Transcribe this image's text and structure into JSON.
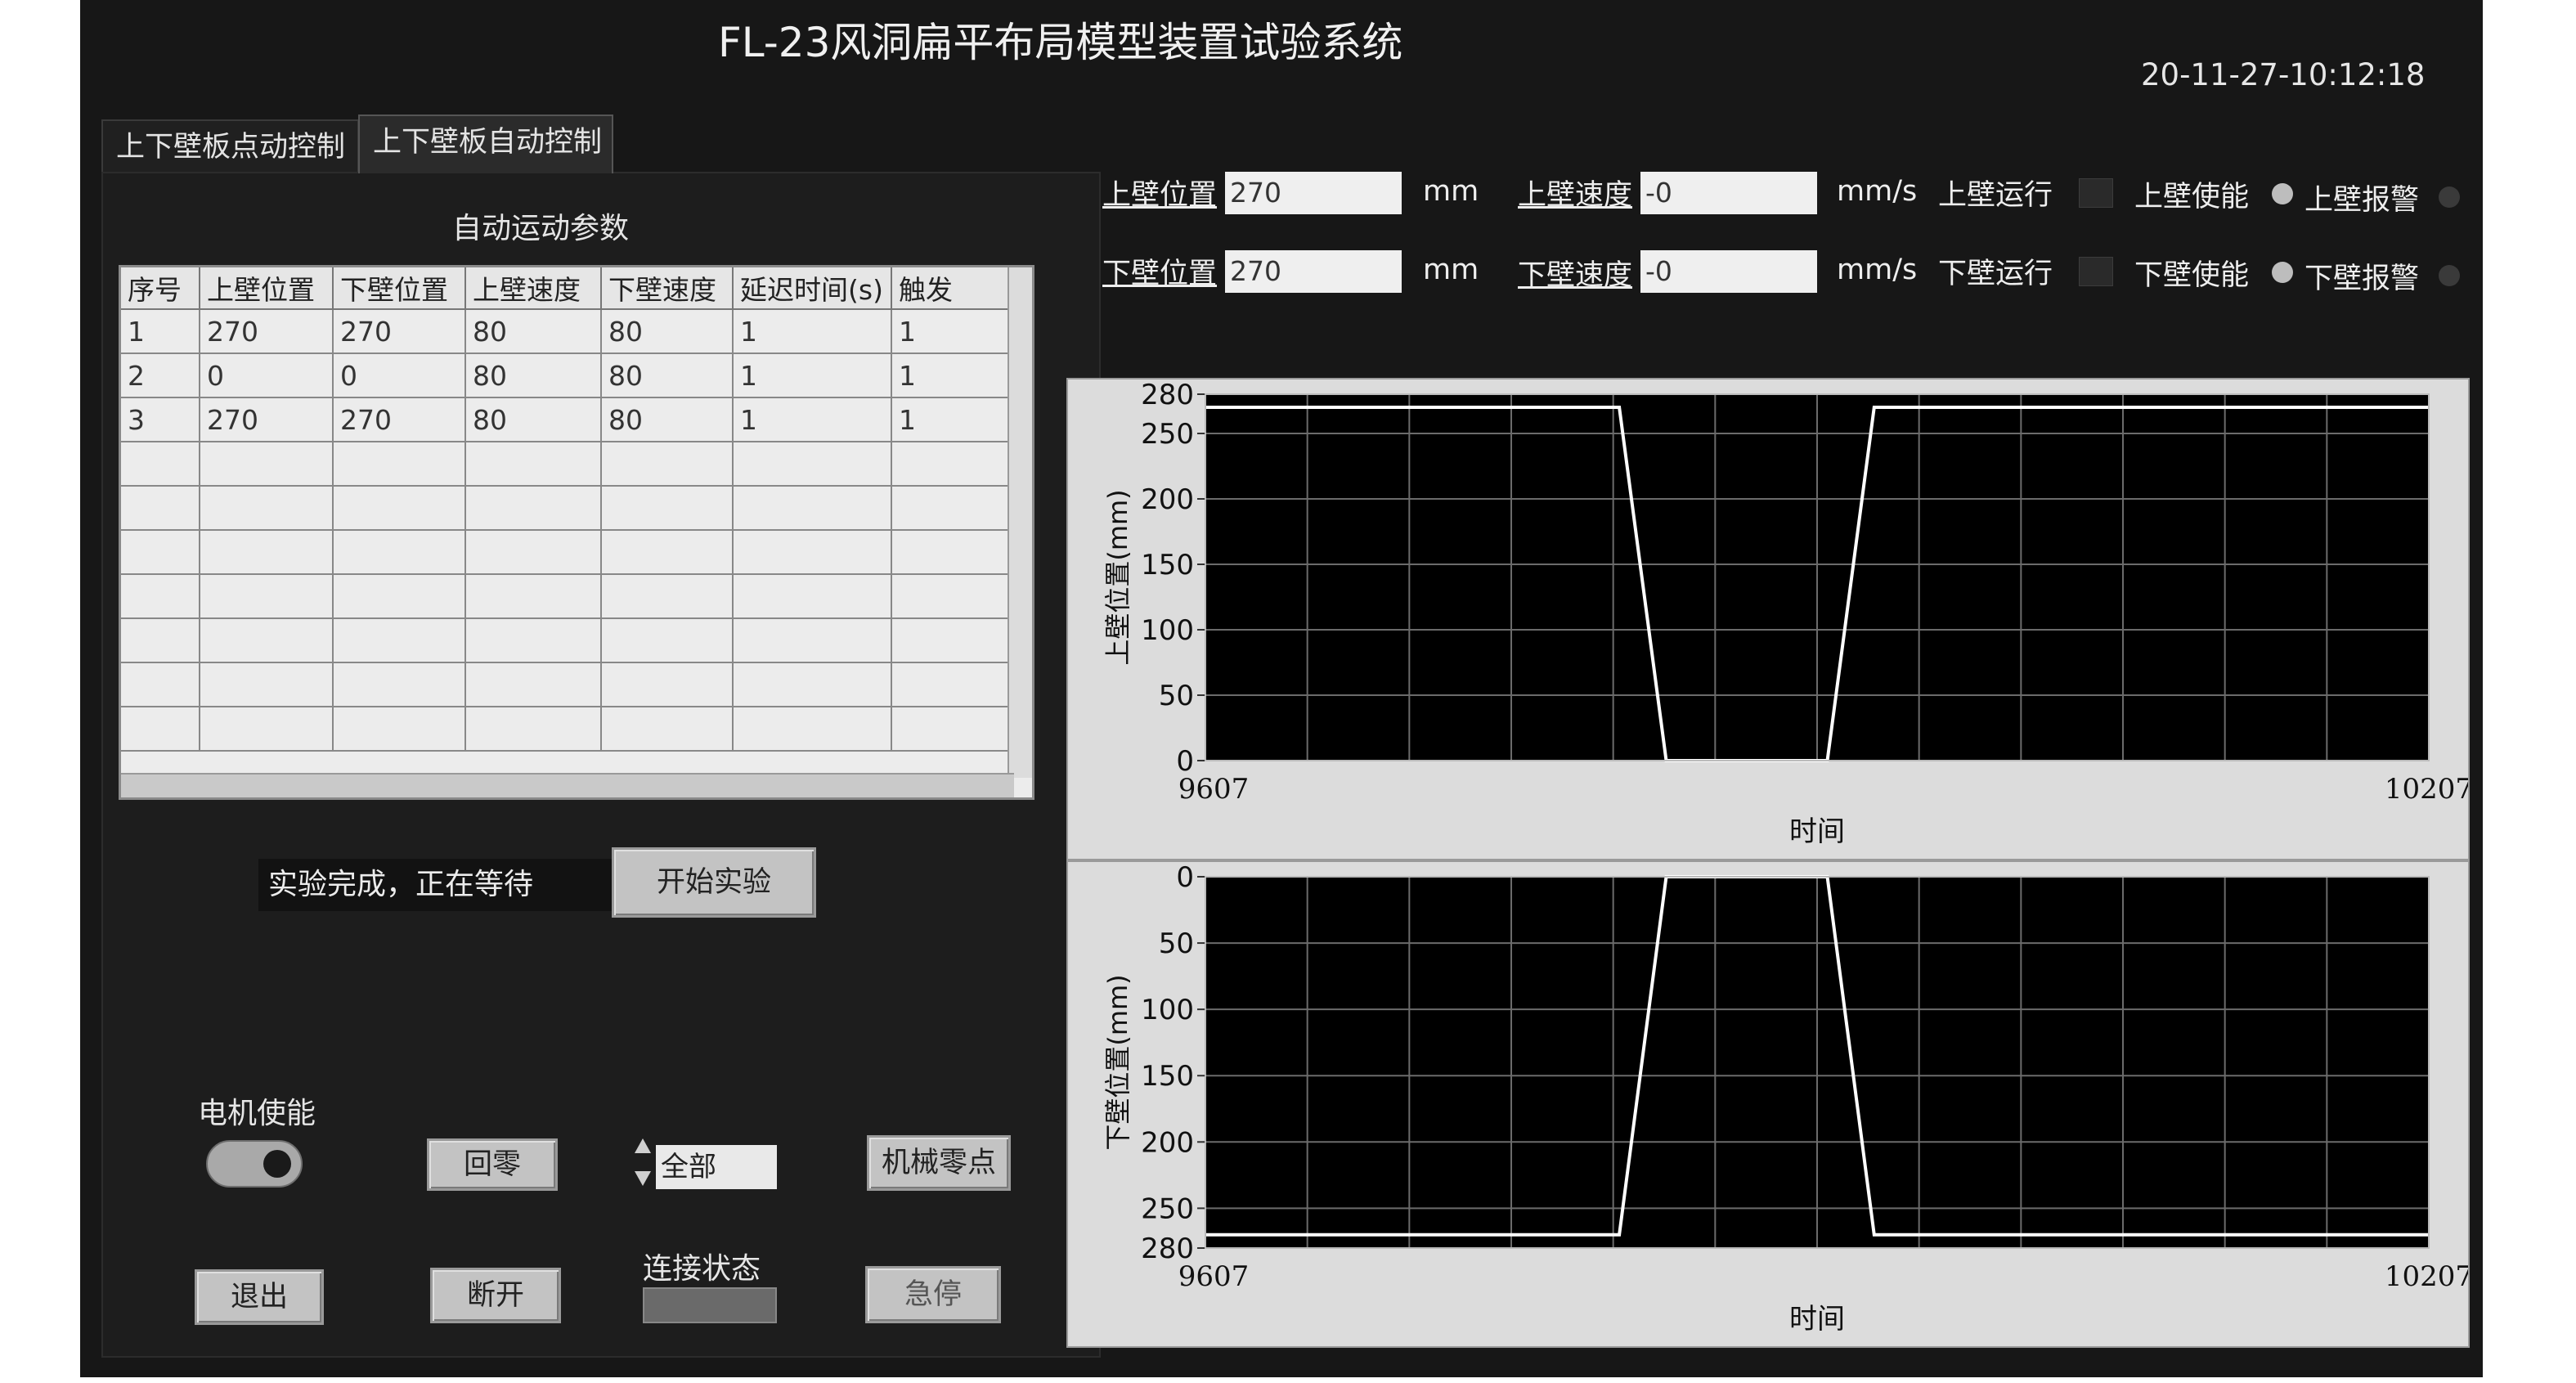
{
  "header": {
    "title": "FL-23风洞扁平布局模型装置试验系统",
    "datetime": "20-11-27-10:12:18"
  },
  "tabs": [
    {
      "label": "上下壁板点动控制"
    },
    {
      "label": "上下壁板自动控制"
    }
  ],
  "auto_params": {
    "title": "自动运动参数",
    "columns": [
      "序号",
      "上壁位置",
      "下壁位置",
      "上壁速度",
      "下壁速度",
      "延迟时间(s)",
      "触发"
    ],
    "rows": [
      [
        "1",
        "270",
        "270",
        "80",
        "80",
        "1",
        "1"
      ],
      [
        "2",
        "0",
        "0",
        "80",
        "80",
        "1",
        "1"
      ],
      [
        "3",
        "270",
        "270",
        "80",
        "80",
        "1",
        "1"
      ]
    ]
  },
  "controls": {
    "status_text": "实验完成，正在等待",
    "start_button": "开始实验",
    "motor_enable_label": "电机使能",
    "home_button": "回零",
    "axis_select_value": "全部",
    "mech_zero_button": "机械零点",
    "exit_button": "退出",
    "disconnect_button": "断开",
    "connection_label": "连接状态",
    "estop_button": "急停"
  },
  "status": {
    "upper": {
      "pos_label": "上壁位置",
      "pos_value": "270",
      "pos_unit": "mm",
      "speed_label": "上壁速度",
      "speed_value": "-0",
      "speed_unit": "mm/s",
      "run_label": "上壁运行",
      "enable_label": "上壁使能",
      "alarm_label": "上壁报警"
    },
    "lower": {
      "pos_label": "下壁位置",
      "pos_value": "270",
      "pos_unit": "mm",
      "speed_label": "下壁速度",
      "speed_value": "-0",
      "speed_unit": "mm/s",
      "run_label": "下壁运行",
      "enable_label": "下壁使能",
      "alarm_label": "下壁报警"
    }
  },
  "chart_data": [
    {
      "type": "line",
      "ylabel": "上壁位置(mm)",
      "xlabel": "时间",
      "xlim": [
        9607,
        10207
      ],
      "ylim": [
        280,
        0
      ],
      "y_inverted": true,
      "y_ticks": [
        0,
        50,
        100,
        150,
        200,
        250,
        280
      ],
      "x_ticks": [
        9607,
        10207
      ],
      "grid": true,
      "series": [
        {
          "x": [
            9607,
            9810,
            9833,
            9850,
            9890,
            9912,
            9935,
            10207
          ],
          "y": [
            270,
            270,
            0,
            0,
            0,
            0,
            270,
            270
          ]
        }
      ]
    },
    {
      "type": "line",
      "ylabel": "下壁位置(mm)",
      "xlabel": "时间",
      "xlim": [
        9607,
        10207
      ],
      "ylim": [
        0,
        280
      ],
      "y_ticks": [
        280,
        250,
        200,
        150,
        100,
        50,
        0
      ],
      "x_ticks": [
        9607,
        10207
      ],
      "grid": true,
      "series": [
        {
          "x": [
            9607,
            9810,
            9833,
            9850,
            9890,
            9912,
            9935,
            10207
          ],
          "y": [
            270,
            270,
            0,
            0,
            0,
            0,
            270,
            270
          ]
        }
      ]
    }
  ],
  "colors": {
    "background": "#171717",
    "plot_background": "#000000",
    "plot_frame": "#dcdcdc",
    "grid": "#6b6b6b",
    "trace": "#ffffff",
    "button": "#c3c3c3",
    "enable_led": "#bdbdbd",
    "alarm_led": "#3a3a3a"
  }
}
